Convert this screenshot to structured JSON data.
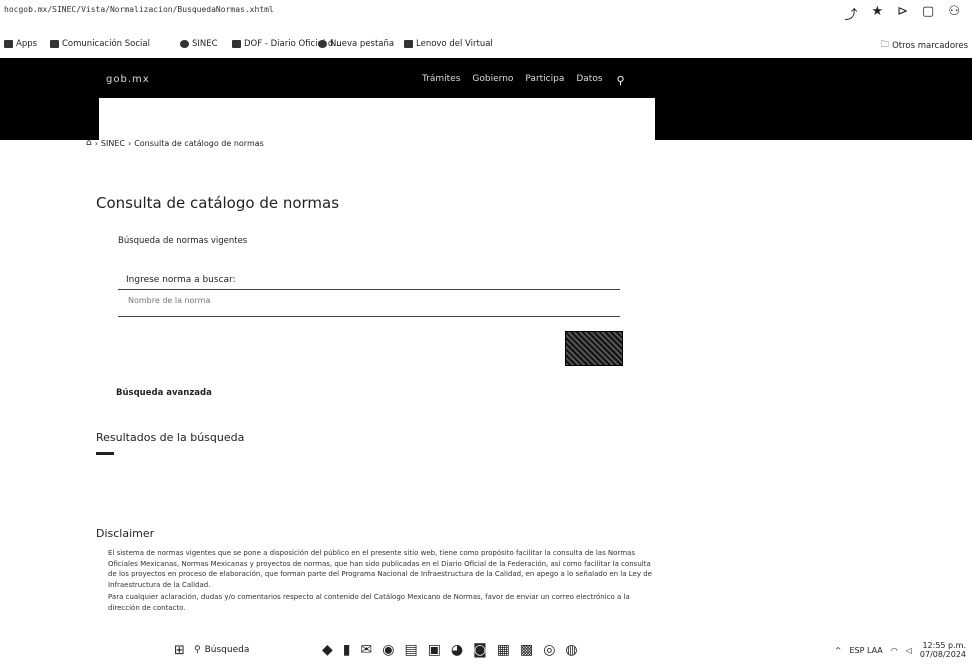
{
  "browser": {
    "url": "hocgob.mx/SINEC/Vista/Normalizacion/BusquedaNormas.xhtml",
    "bookmarks": [
      {
        "label": "Apps"
      },
      {
        "label": "Comunicación Social"
      },
      {
        "label": "SINEC"
      },
      {
        "label": "DOF - Diario Oficial d..."
      },
      {
        "label": "Nueva pestaña"
      },
      {
        "label": "Lenovo del Virtual"
      }
    ],
    "other_bookmarks": "Otros marcadores"
  },
  "site": {
    "brand": "gob.mx",
    "menu": [
      "Trámites",
      "Gobierno",
      "Participa",
      "Datos"
    ]
  },
  "breadcrumb": [
    "SINEC",
    "Consulta de catálogo de normas"
  ],
  "page": {
    "title": "Consulta de catálogo de normas",
    "subtitle": "Búsqueda de normas vigentes",
    "input_label": "Ingrese norma a buscar:",
    "input_placeholder": "Nombre de la norma",
    "advanced_search": "Búsqueda avanzada",
    "results_title": "Resultados de la búsqueda",
    "disclaimer_title": "Disclaimer",
    "disclaimer_paragraphs": [
      "El sistema de normas vigentes que se pone a disposición del público en el presente sitio web, tiene como propósito facilitar la consulta de las Normas Oficiales Mexicanas, Normas Mexicanas y proyectos de normas, que han sido publicadas en el Diario Oficial de la Federación, así como facilitar la consulta de los proyectos en proceso de elaboración, que forman parte del Programa Nacional de Infraestructura de la Calidad, en apego a lo señalado en la Ley de Infraestructura de la Calidad.",
      "Para cualquier aclaración, dudas y/o comentarios respecto al contenido del Catálogo Mexicano de Normas, favor de enviar un correo electrónico a la dirección de contacto."
    ]
  },
  "taskbar": {
    "search_label": "Búsqueda",
    "tray_lang": "ESP LAA",
    "time": "12:55 p.m.",
    "date": "07/08/2024"
  }
}
